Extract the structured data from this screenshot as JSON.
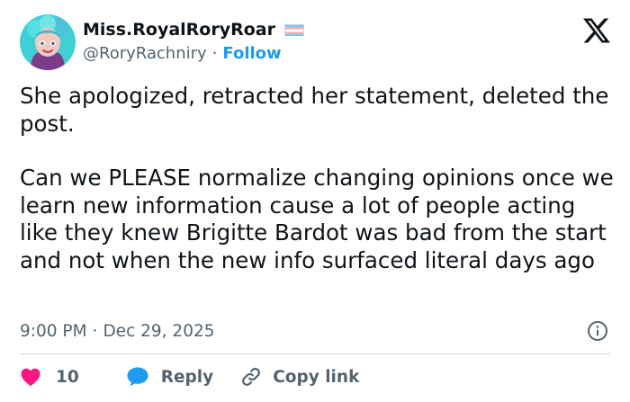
{
  "author": {
    "display_name": "Miss.RoyalRoryRoar",
    "handle": "@RoryRachniry",
    "separator": "·",
    "follow_label": "Follow"
  },
  "tweet": {
    "paragraph_1": "She apologized, retracted her statement, deleted the post.",
    "paragraph_2": "Can we PLEASE normalize changing opinions once we learn new information cause a lot of people acting like they knew Brigitte Bardot was bad from the start and not when the new info surfaced literal days ago",
    "time": "9:00 PM",
    "separator": "·",
    "date": "Dec 29, 2025"
  },
  "actions": {
    "like_count": "10",
    "reply_label": "Reply",
    "copy_link_label": "Copy link"
  },
  "colors": {
    "accent": "#1d9bf0",
    "like": "#f91880",
    "text": "#0f1419",
    "muted": "#536471",
    "divider": "#cfd9de",
    "flag_blue": "#5bcefa",
    "flag_pink": "#f5a9b8"
  },
  "icons": [
    "x-logo-icon",
    "transgender-flag-icon",
    "heart-icon",
    "reply-bubble-icon",
    "link-icon",
    "info-icon"
  ]
}
